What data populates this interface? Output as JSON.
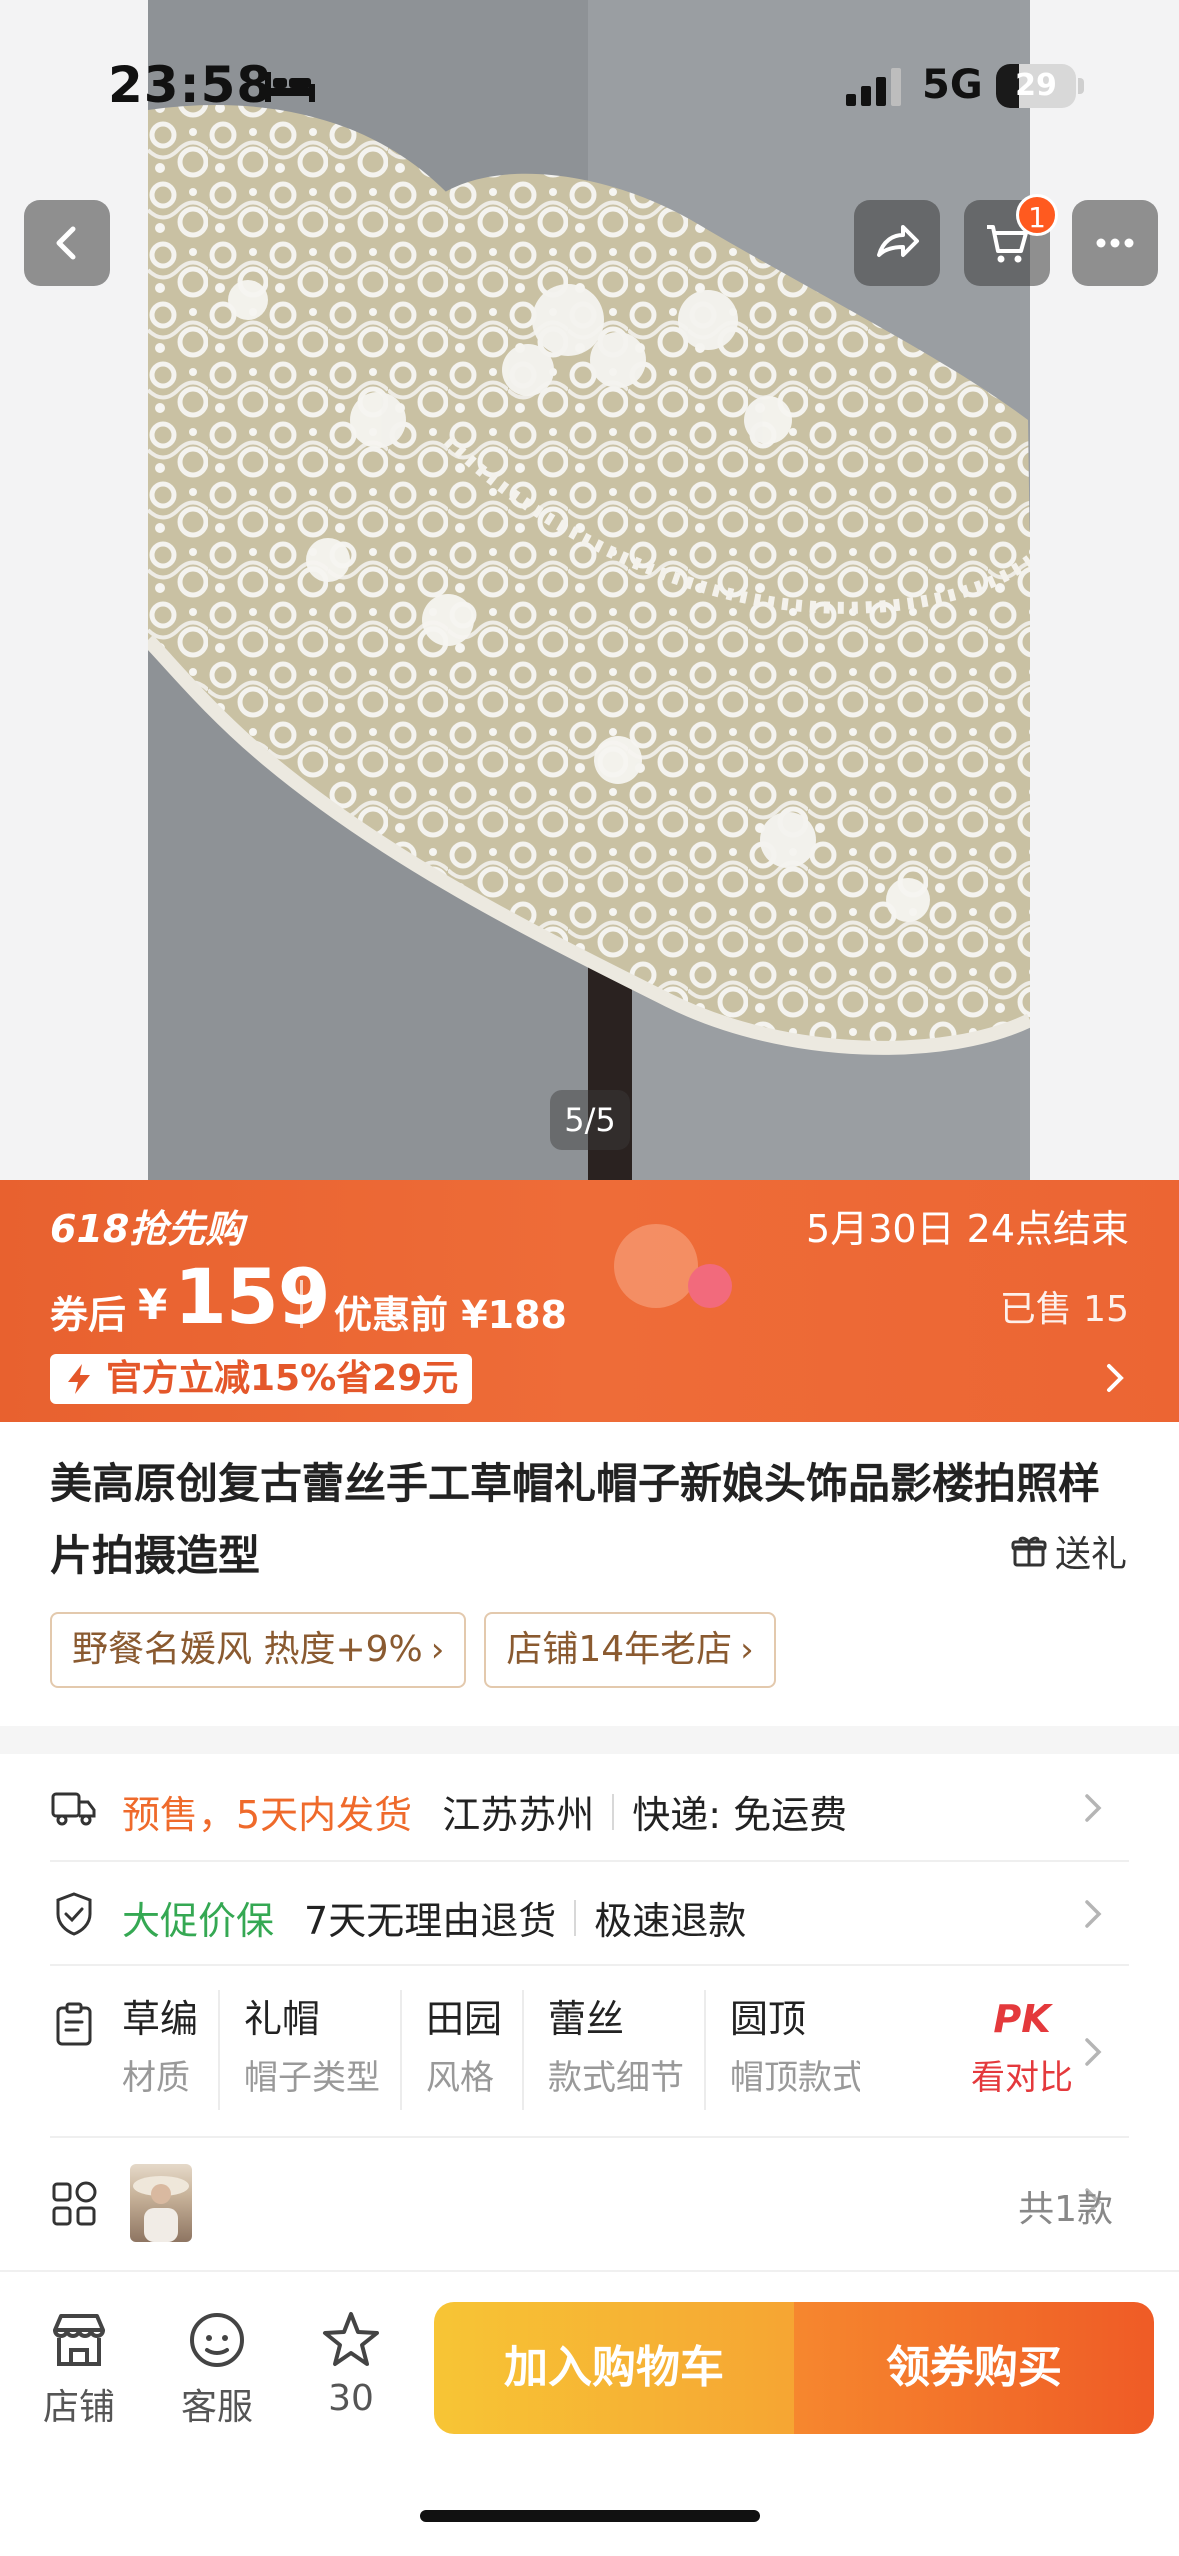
{
  "status_bar": {
    "time": "23:58",
    "network": "5G",
    "battery_level": "29",
    "battery_fraction": 0.29
  },
  "gallery": {
    "counter": "5/5",
    "cart_badge": "1"
  },
  "promo": {
    "event": "618抢先购",
    "coupon_label": "券后",
    "currency": "¥",
    "price": "159",
    "original_label": "优惠前 ¥188",
    "deadline": "5月30日 24点结束",
    "sold": "已售 15",
    "discount": "官方立减15%省29元",
    "colors": {
      "banner": "#ec6533",
      "discount_text": "#e4572a"
    }
  },
  "product": {
    "title": "美高原创复古蕾丝手工草帽礼帽子新娘头饰品影楼拍照样片拍摄造型",
    "gift_label": "送礼",
    "tags": [
      "野餐名媛风 热度+9%",
      "店铺14年老店"
    ]
  },
  "services": {
    "shipping": {
      "highlight": "预售，5天内发货",
      "location": "江苏苏州",
      "delivery": "快递: 免运费"
    },
    "guarantee": {
      "highlight": "大促价保",
      "return": "7天无理由退货",
      "refund": "极速退款"
    }
  },
  "attributes": [
    {
      "value": "草编",
      "key": "材质"
    },
    {
      "value": "礼帽",
      "key": "帽子类型"
    },
    {
      "value": "田园",
      "key": "风格"
    },
    {
      "value": "蕾丝",
      "key": "款式细节"
    },
    {
      "value": "圆顶",
      "key": "帽顶款式"
    }
  ],
  "compare": {
    "pk": "PK",
    "label": "看对比"
  },
  "variants": {
    "count_label": "共1款"
  },
  "bottom_bar": {
    "shop": "店铺",
    "service": "客服",
    "favorites": "30",
    "add_to_cart": "加入购物车",
    "buy": "领券购买"
  },
  "icons": [
    "back-icon",
    "share-icon",
    "cart-icon",
    "more-icon",
    "lightning-icon",
    "gift-icon",
    "truck-icon",
    "shield-icon",
    "clipboard-icon",
    "grid-icon",
    "store-icon",
    "chat-icon",
    "star-icon",
    "chevron-right-icon"
  ]
}
